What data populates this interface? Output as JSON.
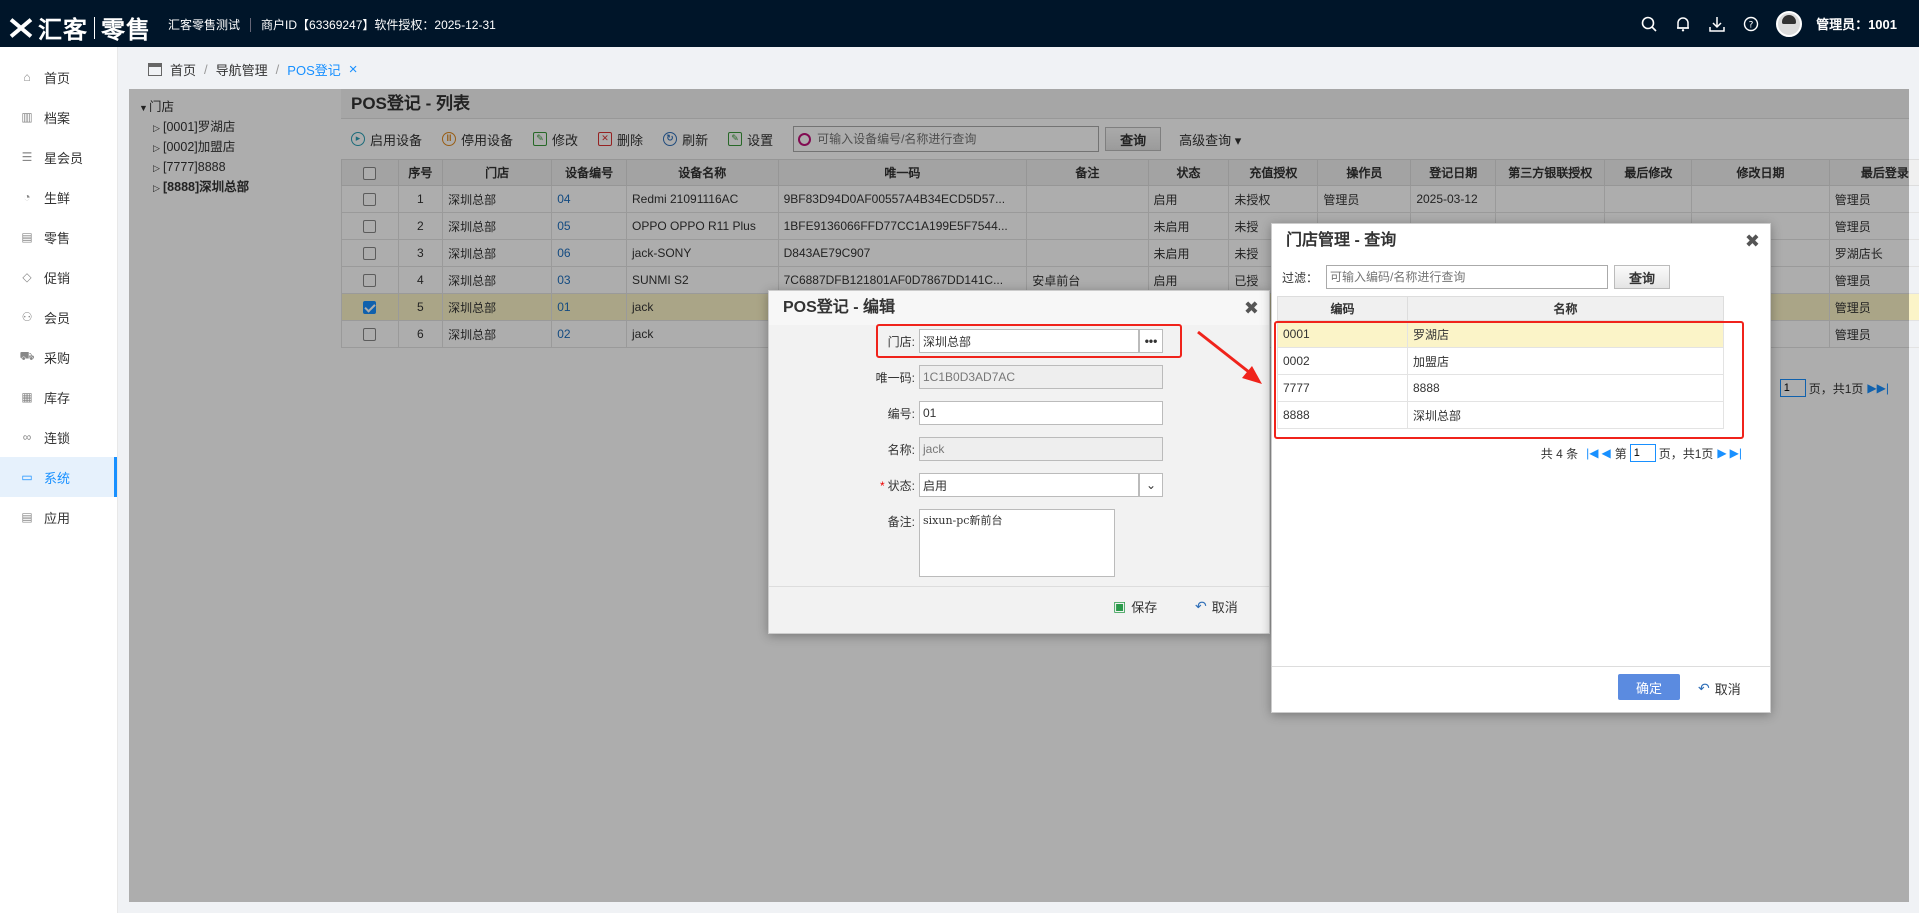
{
  "brand": {
    "logo_text": "汇客",
    "logo_sub": "零售",
    "store_name": "汇客零售测试",
    "merchant_info": "商户ID【63369247】软件授权：2025-12-31"
  },
  "user": {
    "label": "管理员：1001"
  },
  "sidebar": {
    "items": [
      {
        "label": "首页",
        "icon": "home-icon"
      },
      {
        "label": "档案",
        "icon": "archive-icon"
      },
      {
        "label": "星会员",
        "icon": "star-member-icon"
      },
      {
        "label": "生鲜",
        "icon": "fresh-icon"
      },
      {
        "label": "零售",
        "icon": "retail-icon"
      },
      {
        "label": "促销",
        "icon": "tag-icon"
      },
      {
        "label": "会员",
        "icon": "member-icon"
      },
      {
        "label": "采购",
        "icon": "cart-icon"
      },
      {
        "label": "库存",
        "icon": "warehouse-icon"
      },
      {
        "label": "连锁",
        "icon": "chain-icon"
      },
      {
        "label": "系统",
        "icon": "monitor-icon",
        "active": true
      },
      {
        "label": "应用",
        "icon": "app-icon"
      }
    ]
  },
  "breadcrumb": {
    "home": "首页",
    "nav": "导航管理",
    "current": "POS登记"
  },
  "tree": {
    "root": "门店",
    "children": [
      "[0001]罗湖店",
      "[0002]加盟店",
      "[7777]8888",
      "[8888]深圳总部"
    ]
  },
  "list": {
    "title": "POS登记 - 列表",
    "toolbar": {
      "enable": "启用设备",
      "disable": "停用设备",
      "edit": "修改",
      "delete": "删除",
      "refresh": "刷新",
      "settings": "设置",
      "search_placeholder": "可输入设备编号/名称进行查询",
      "search_btn": "查询",
      "advanced": "高级查询"
    },
    "columns": [
      "序号",
      "门店",
      "设备编号",
      "设备名称",
      "唯一码",
      "备注",
      "状态",
      "充值授权",
      "操作员",
      "登记日期",
      "第三方银联授权",
      "最后修改",
      "修改日期",
      "最后登录"
    ],
    "rows": [
      {
        "no": "1",
        "store": "深圳总部",
        "code": "04",
        "name": "Redmi 21091116AC",
        "uid": "9BF83D94D0AF00557A4B34ECD5D57...",
        "remark": "",
        "status": "启用",
        "auth": "未授权",
        "op": "管理员",
        "date": "2025-03-12",
        "last": "管理员",
        "checked": false
      },
      {
        "no": "2",
        "store": "深圳总部",
        "code": "05",
        "name": "OPPO OPPO R11 Plus",
        "uid": "1BFE9136066FFD77CC1A199E5F7544...",
        "remark": "",
        "status": "未启用",
        "auth": "未授",
        "op": "",
        "date": "",
        "last": "管理员",
        "checked": false
      },
      {
        "no": "3",
        "store": "深圳总部",
        "code": "06",
        "name": "jack-SONY",
        "uid": "D843AE79C907",
        "remark": "",
        "status": "未启用",
        "auth": "未授",
        "op": "",
        "date": "",
        "last": "罗湖店长",
        "checked": false
      },
      {
        "no": "4",
        "store": "深圳总部",
        "code": "03",
        "name": "SUNMI S2",
        "uid": "7C6887DFB121801AF0D7867DD141C...",
        "remark": "安卓前台",
        "status": "启用",
        "auth": "已授",
        "op": "",
        "date": "",
        "last": "管理员",
        "checked": false
      },
      {
        "no": "5",
        "store": "深圳总部",
        "code": "01",
        "name": "jack",
        "uid": "",
        "remark": "",
        "status": "",
        "auth": "",
        "op": "",
        "date": "",
        "last": "管理员",
        "checked": true
      },
      {
        "no": "6",
        "store": "深圳总部",
        "code": "02",
        "name": "jack",
        "uid": "",
        "remark": "",
        "status": "",
        "auth": "",
        "op": "",
        "date": "",
        "last": "管理员",
        "checked": false
      }
    ],
    "pager": {
      "page": "1",
      "total_pages": "页，共1页"
    }
  },
  "edit_dialog": {
    "title": "POS登记 - 编辑",
    "store_label": "门店:",
    "store_value": "深圳总部",
    "uid_label": "唯一码:",
    "uid_value": "1C1B0D3AD7AC",
    "code_label": "编号:",
    "code_value": "01",
    "name_label": "名称:",
    "name_value": "jack",
    "status_label": "状态:",
    "status_value": "启用",
    "remark_label": "备注:",
    "remark_value": "sixun-pc新前台",
    "save": "保存",
    "cancel": "取消"
  },
  "query_dialog": {
    "title": "门店管理 - 查询",
    "filter_label": "过滤：",
    "filter_placeholder": "可输入编码/名称进行查询",
    "query_btn": "查询",
    "columns": [
      "编码",
      "名称"
    ],
    "rows": [
      {
        "code": "0001",
        "name": "罗湖店"
      },
      {
        "code": "0002",
        "name": "加盟店"
      },
      {
        "code": "7777",
        "name": "8888"
      },
      {
        "code": "8888",
        "name": "深圳总部"
      }
    ],
    "pager": {
      "total": "共 4 条",
      "page_prefix": "第",
      "page": "1",
      "page_suffix": "页，共1页"
    },
    "ok": "确定",
    "cancel": "取消"
  },
  "colors": {
    "topbar": "#001529",
    "accent": "#1890ff",
    "highlight": "#f0231b",
    "selected_row": "#fbf4c8"
  }
}
